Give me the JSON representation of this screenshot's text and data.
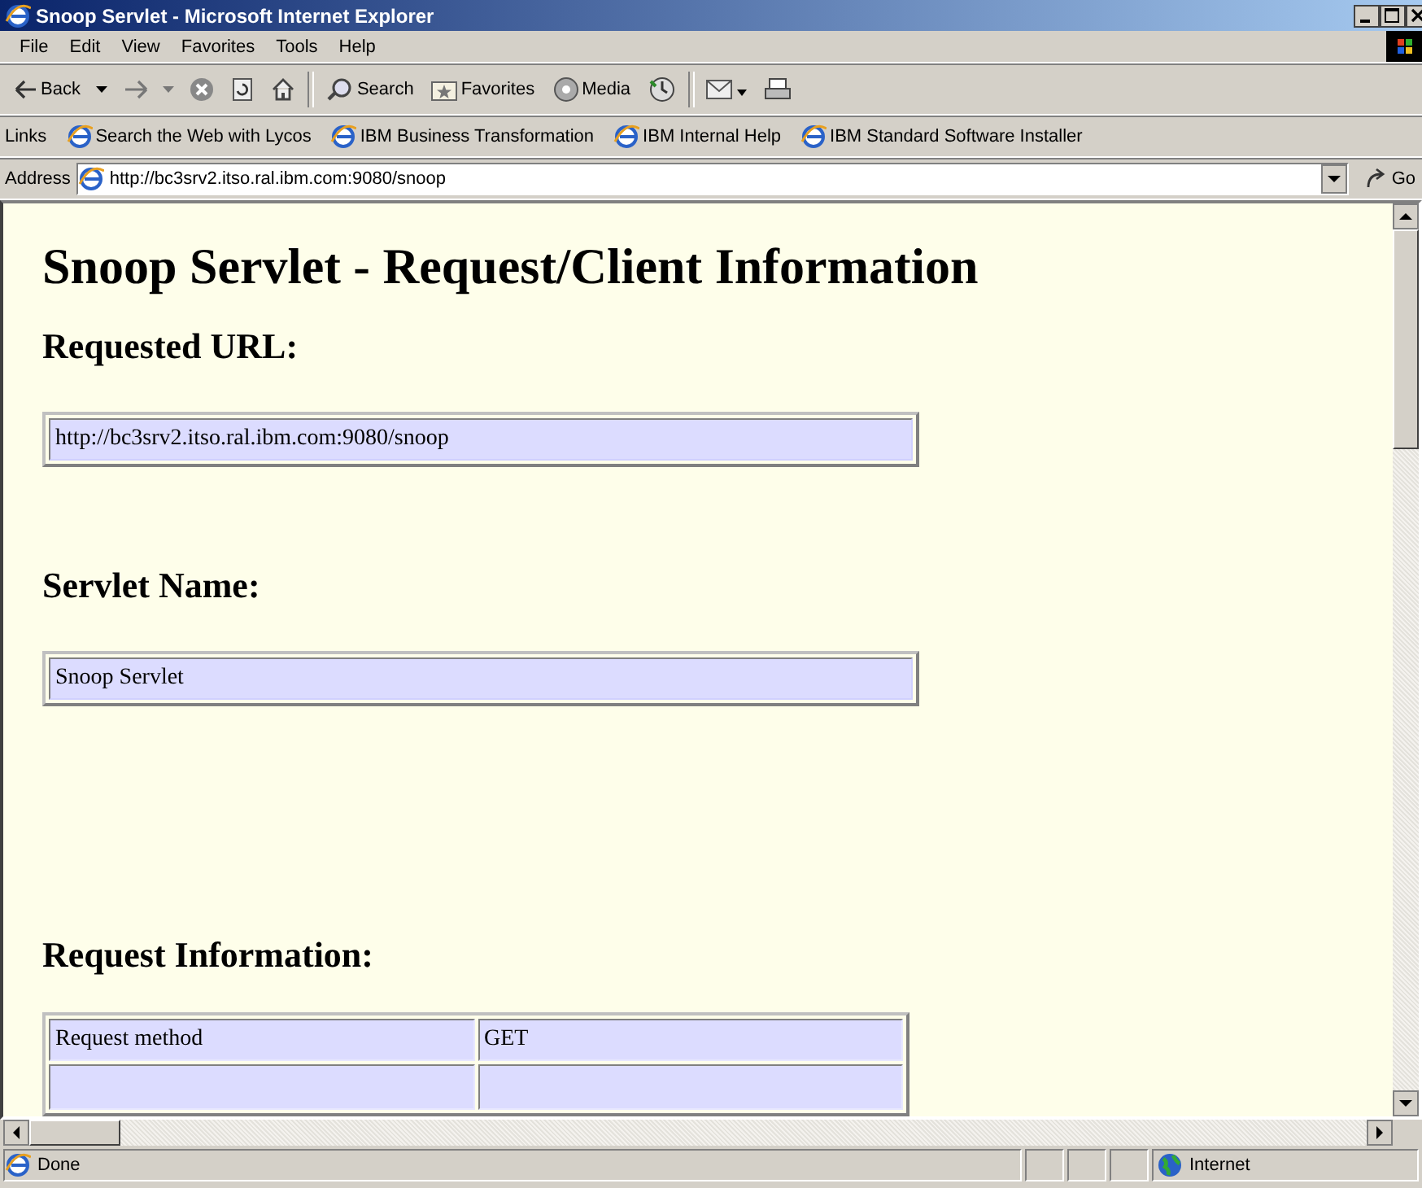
{
  "window": {
    "title": "Snoop Servlet - Microsoft Internet Explorer"
  },
  "menu": [
    "File",
    "Edit",
    "View",
    "Favorites",
    "Tools",
    "Help"
  ],
  "toolbar": {
    "back": "Back",
    "search": "Search",
    "favorites": "Favorites",
    "media": "Media"
  },
  "links": {
    "label": "Links",
    "items": [
      "Search the Web with Lycos",
      "IBM Business Transformation",
      "IBM Internal Help",
      "IBM Standard Software Installer"
    ]
  },
  "address": {
    "label": "Address",
    "value": "http://bc3srv2.itso.ral.ibm.com:9080/snoop",
    "go": "Go"
  },
  "page": {
    "title": "Snoop Servlet - Request/Client Information",
    "sections": [
      {
        "heading": "Requested URL:",
        "kind": "box",
        "value": "http://bc3srv2.itso.ral.ibm.com:9080/snoop"
      },
      {
        "heading": "Servlet Name:",
        "kind": "box",
        "value": "Snoop Servlet"
      },
      {
        "heading": "Request Information:",
        "kind": "table",
        "rows": [
          [
            "Request method",
            "GET"
          ]
        ]
      }
    ]
  },
  "status_bar": {
    "text": "Done",
    "zone": "Internet"
  }
}
